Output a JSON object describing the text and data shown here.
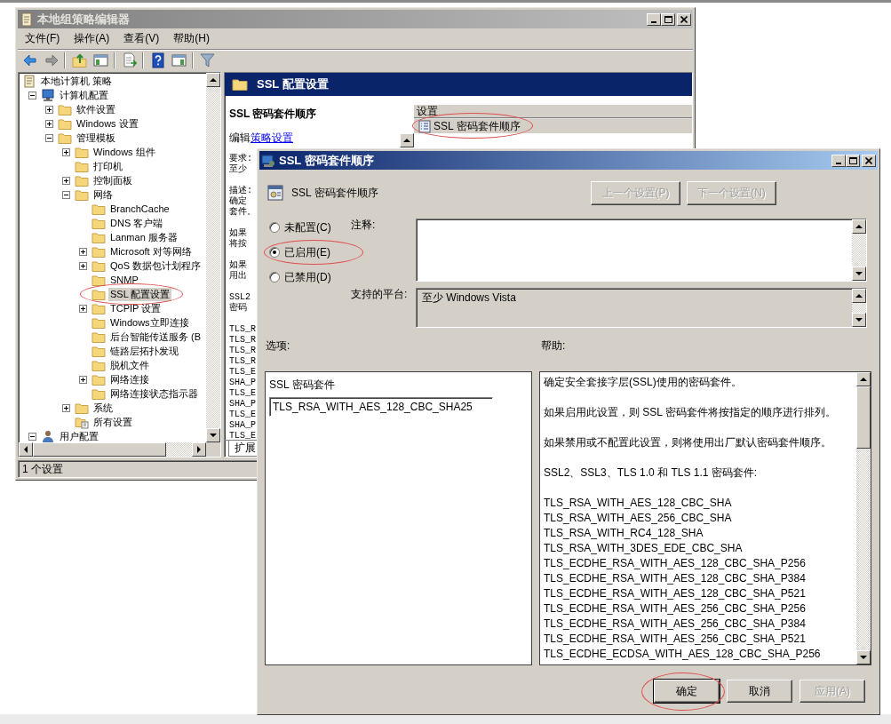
{
  "main_window": {
    "title": "本地组策略编辑器"
  },
  "menu": [
    "文件(F)",
    "操作(A)",
    "查看(V)",
    "帮助(H)"
  ],
  "tree": [
    {
      "label": "本地计算机 策略",
      "kind": "policy",
      "selected": false,
      "circled": false,
      "children": [
        {
          "label": "计算机配置",
          "kind": "computer",
          "expanded": true,
          "selected": false,
          "circled": false,
          "children": [
            {
              "label": "软件设置",
              "kind": "folder",
              "expanded": false,
              "selected": false,
              "circled": false
            },
            {
              "label": "Windows 设置",
              "kind": "folder",
              "expanded": false,
              "selected": false,
              "circled": false
            },
            {
              "label": "管理模板",
              "kind": "folder",
              "expanded": true,
              "selected": false,
              "circled": false,
              "children": [
                {
                  "label": "Windows 组件",
                  "kind": "folder",
                  "expanded": false,
                  "selected": false,
                  "circled": false
                },
                {
                  "label": "打印机",
                  "kind": "folder",
                  "selected": false,
                  "circled": false
                },
                {
                  "label": "控制面板",
                  "kind": "folder",
                  "expanded": false,
                  "selected": false,
                  "circled": false
                },
                {
                  "label": "网络",
                  "kind": "folder",
                  "expanded": true,
                  "selected": false,
                  "circled": false,
                  "children": [
                    {
                      "label": "BranchCache",
                      "kind": "folder",
                      "selected": false,
                      "circled": false
                    },
                    {
                      "label": "DNS 客户端",
                      "kind": "folder",
                      "selected": false,
                      "circled": false
                    },
                    {
                      "label": "Lanman 服务器",
                      "kind": "folder",
                      "selected": false,
                      "circled": false
                    },
                    {
                      "label": "Microsoft 对等网络",
                      "kind": "folder",
                      "expanded": false,
                      "selected": false,
                      "circled": false
                    },
                    {
                      "label": "QoS 数据包计划程序",
                      "kind": "folder",
                      "expanded": false,
                      "selected": false,
                      "circled": false
                    },
                    {
                      "label": "SNMP",
                      "kind": "folder",
                      "selected": false,
                      "circled": false
                    },
                    {
                      "label": "SSL 配置设置",
                      "kind": "folder",
                      "selected": true,
                      "circled": true
                    },
                    {
                      "label": "TCPIP 设置",
                      "kind": "folder",
                      "expanded": false,
                      "selected": false,
                      "circled": false
                    },
                    {
                      "label": "Windows立即连接",
                      "kind": "folder",
                      "selected": false,
                      "circled": false
                    },
                    {
                      "label": "后台智能传送服务 (B",
                      "kind": "folder",
                      "selected": false,
                      "circled": false
                    },
                    {
                      "label": "链路层拓扑发现",
                      "kind": "folder",
                      "selected": false,
                      "circled": false
                    },
                    {
                      "label": "脱机文件",
                      "kind": "folder",
                      "selected": false,
                      "circled": false
                    },
                    {
                      "label": "网络连接",
                      "kind": "folder",
                      "expanded": false,
                      "selected": false,
                      "circled": false
                    },
                    {
                      "label": "网络连接状态指示器",
                      "kind": "folder",
                      "selected": false,
                      "circled": false
                    }
                  ]
                },
                {
                  "label": "系统",
                  "kind": "folder",
                  "expanded": false,
                  "selected": false,
                  "circled": false
                },
                {
                  "label": "所有设置",
                  "kind": "all-settings",
                  "selected": false,
                  "circled": false
                }
              ]
            }
          ]
        },
        {
          "label": "用户配置",
          "kind": "user",
          "expanded": true,
          "selected": false,
          "circled": false
        }
      ]
    }
  ],
  "details": {
    "header": "SSL 配置设置",
    "title": "SSL 密码套件顺序",
    "edit_prefix": "编辑",
    "edit_link": "策略设置",
    "fragments": [
      [
        "要求:",
        "至少"
      ],
      [
        "描述:",
        "确定",
        "套件。"
      ],
      [
        "如果",
        "将按"
      ],
      [
        "如果",
        "用出"
      ],
      [
        "SSL2",
        "密码"
      ],
      [
        "TLS_R",
        "TLS_R",
        "TLS_R",
        "TLS_R",
        "TLS_E",
        "SHA_P",
        "TLS_E",
        "SHA_P",
        "TLS_E",
        "SHA_P",
        "TLS_E"
      ]
    ],
    "column": "设置",
    "settings": [
      {
        "label": "SSL 密码套件顺序",
        "selected": true,
        "circled": true
      }
    ],
    "tabs": [
      {
        "label": "扩展",
        "selected": true
      }
    ]
  },
  "status_bar": "1 个设置",
  "dialog": {
    "title": "SSL 密码套件顺序",
    "heading": "SSL 密码套件顺序",
    "nav_buttons": [
      {
        "label": "上一个设置(P)",
        "disabled": true
      },
      {
        "label": "下一个设置(N)",
        "disabled": true
      }
    ],
    "radios": [
      {
        "label": "未配置(C)",
        "selected": false,
        "circled": false
      },
      {
        "label": "已启用(E)",
        "selected": true,
        "circled": true
      },
      {
        "label": "已禁用(D)",
        "selected": false,
        "circled": false
      }
    ],
    "comment_label": "注释:",
    "platform_label": "支持的平台:",
    "platform": "至少 Windows Vista",
    "options_label": "选项:",
    "help_label": "帮助:",
    "option_field": {
      "label": "SSL 密码套件",
      "value": "TLS_RSA_WITH_AES_128_CBC_SHA25"
    },
    "help_paragraphs": [
      "确定安全套接字层(SSL)使用的密码套件。",
      "如果启用此设置，则 SSL 密码套件将按指定的顺序进行排列。",
      "如果禁用或不配置此设置，则将使用出厂默认密码套件顺序。",
      "SSL2、SSL3、TLS 1.0 和 TLS 1.1 密码套件:"
    ],
    "help_ciphers": [
      "TLS_RSA_WITH_AES_128_CBC_SHA",
      "TLS_RSA_WITH_AES_256_CBC_SHA",
      "TLS_RSA_WITH_RC4_128_SHA",
      "TLS_RSA_WITH_3DES_EDE_CBC_SHA",
      "TLS_ECDHE_RSA_WITH_AES_128_CBC_SHA_P256",
      "TLS_ECDHE_RSA_WITH_AES_128_CBC_SHA_P384",
      "TLS_ECDHE_RSA_WITH_AES_128_CBC_SHA_P521",
      "TLS_ECDHE_RSA_WITH_AES_256_CBC_SHA_P256",
      "TLS_ECDHE_RSA_WITH_AES_256_CBC_SHA_P384",
      "TLS_ECDHE_RSA_WITH_AES_256_CBC_SHA_P521",
      "TLS_ECDHE_ECDSA_WITH_AES_128_CBC_SHA_P256"
    ],
    "buttons": [
      {
        "label": "确定",
        "default": true,
        "disabled": false,
        "circled": true
      },
      {
        "label": "取消",
        "default": false,
        "disabled": false,
        "circled": false
      },
      {
        "label": "应用(A)",
        "default": false,
        "disabled": true,
        "circled": false
      }
    ]
  }
}
